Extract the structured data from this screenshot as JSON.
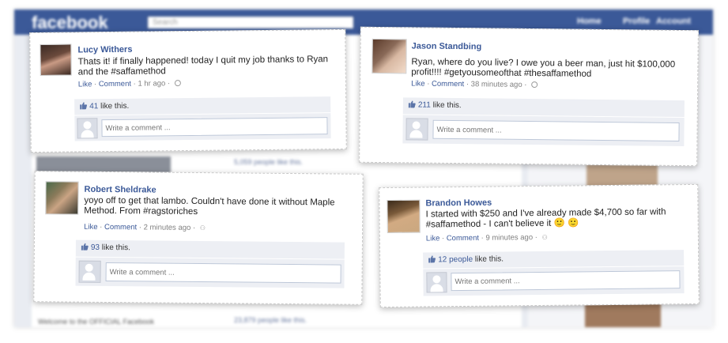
{
  "background": {
    "logo": "facebook",
    "search_placeholder": "Search",
    "nav": [
      "Home",
      "Profile",
      "Account"
    ],
    "blurred_like_1": "5,059 people like this.",
    "blurred_like_2": "23,879 people like this.",
    "blurred_welcome": "Welcome to the OFFICIAL Facebook"
  },
  "colors": {
    "brand": "#3b5998",
    "card_bg": "#ffffff",
    "like_bar": "#edeff4"
  },
  "posts": [
    {
      "name": "Lucy Withers",
      "message": "Thats it! if finally happened! today I quit my job thanks to Ryan and the #saffamethod",
      "like_link": "Like",
      "comment_link": "Comment",
      "time": "1 hr ago",
      "privacy_icon": "globe-icon",
      "like_count": "41",
      "like_suffix": "like this.",
      "comment_placeholder": "Write a comment ..."
    },
    {
      "name": "Jason Standbing",
      "message": "Ryan, where do you live? I owe you a beer man, just hit $100,000 profit!!!! #getyousomeofthat #thesaffamethod",
      "like_link": "Like",
      "comment_link": "Comment",
      "time": "38 minutes ago",
      "privacy_icon": "globe-icon",
      "like_count": "211",
      "like_suffix": "like this.",
      "comment_placeholder": "Write a comment ..."
    },
    {
      "name": "Robert Sheldrake",
      "message": "yoyo off to get that lambo. Couldn't have done it without Maple Method. From #ragstoriches",
      "like_link": "Like",
      "comment_link": "Comment",
      "time": "2 minutes ago",
      "privacy_icon": "friends-icon",
      "like_count": "93",
      "like_suffix": "like this.",
      "comment_placeholder": "Write a comment ..."
    },
    {
      "name": "Brandon Howes",
      "message": "I started with $250 and I've already made $4,700 so far with #saffamethod - I can't believe it 🙂 🙂",
      "like_link": "Like",
      "comment_link": "Comment",
      "time": "9 minutes ago",
      "privacy_icon": "friends-icon",
      "like_count": "12 people",
      "like_suffix": "like this.",
      "comment_placeholder": "Write a comment ..."
    }
  ]
}
